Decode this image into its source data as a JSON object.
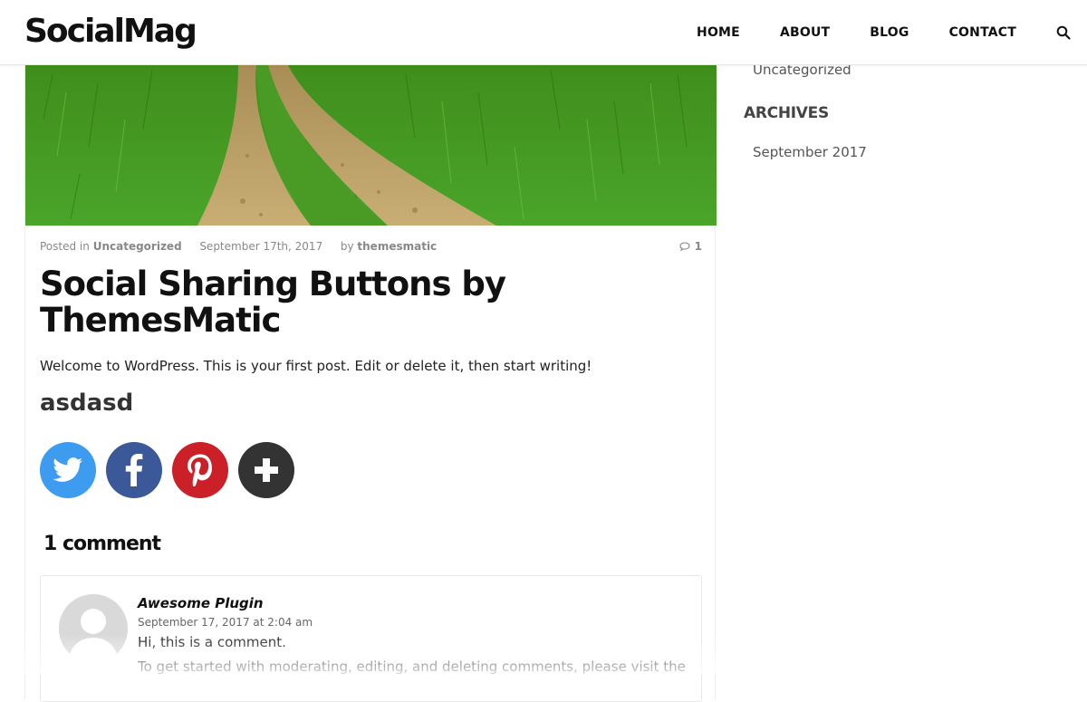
{
  "site": {
    "logo": "SocialMag"
  },
  "nav": {
    "items": [
      {
        "label": "HOME"
      },
      {
        "label": "ABOUT"
      },
      {
        "label": "BLOG"
      },
      {
        "label": "CONTACT"
      }
    ],
    "search_icon": "search-icon"
  },
  "post": {
    "meta": {
      "posted_in_prefix": "Posted in",
      "category": "Uncategorized",
      "date": "September 17th, 2017",
      "by_prefix": "by",
      "author": "themesmatic",
      "comment_count": "1"
    },
    "title": "Social Sharing Buttons by ThemesMatic",
    "excerpt": "Welcome to WordPress. This is your first post. Edit or delete it, then start writing!",
    "subheading": "asdasd",
    "share_buttons": [
      {
        "name": "twitter",
        "color": "#3d9bf0"
      },
      {
        "name": "facebook",
        "color": "#3b5998"
      },
      {
        "name": "pinterest",
        "color": "#cb2027"
      },
      {
        "name": "more",
        "color": "#333333"
      }
    ]
  },
  "comments": {
    "title": "1 comment",
    "items": [
      {
        "author": "Awesome Plugin",
        "date": "September 17, 2017 at 2:04 am",
        "text1": "Hi, this is a comment.",
        "text2": "To get started with moderating, editing, and deleting comments, please visit the"
      }
    ]
  },
  "sidebar": {
    "category": "Uncategorized",
    "archives_heading": "ARCHIVES",
    "archive_item": "September 2017"
  }
}
